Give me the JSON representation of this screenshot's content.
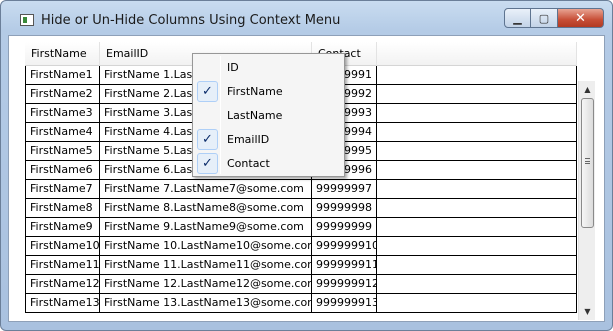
{
  "window": {
    "title": "Hide or Un-Hide Columns Using Context Menu",
    "minimize_glyph": "▁",
    "maximize_glyph": "▢",
    "close_glyph": "✕"
  },
  "grid": {
    "headers": [
      "FirstName",
      "EmailID",
      "Contact",
      ""
    ],
    "rows": [
      [
        "FirstName1",
        "FirstName 1.LastName1@some.com",
        "99999991",
        ""
      ],
      [
        "FirstName2",
        "FirstName 2.LastName2@some.com",
        "99999992",
        ""
      ],
      [
        "FirstName3",
        "FirstName 3.LastName3@some.com",
        "99999993",
        ""
      ],
      [
        "FirstName4",
        "FirstName 4.LastName4@some.com",
        "99999994",
        ""
      ],
      [
        "FirstName5",
        "FirstName 5.LastName5@some.com",
        "99999995",
        ""
      ],
      [
        "FirstName6",
        "FirstName 6.LastName6@some.com",
        "99999996",
        ""
      ],
      [
        "FirstName7",
        "FirstName 7.LastName7@some.com",
        "99999997",
        ""
      ],
      [
        "FirstName8",
        "FirstName 8.LastName8@some.com",
        "99999998",
        ""
      ],
      [
        "FirstName9",
        "FirstName 9.LastName9@some.com",
        "99999999",
        ""
      ],
      [
        "FirstName10",
        "FirstName 10.LastName10@some.com",
        "999999910",
        ""
      ],
      [
        "FirstName11",
        "FirstName 11.LastName11@some.com",
        "999999911",
        ""
      ],
      [
        "FirstName12",
        "FirstName 12.LastName12@some.com",
        "999999912",
        ""
      ],
      [
        "FirstName13",
        "FirstName 13.LastName13@some.com",
        "999999913",
        ""
      ]
    ]
  },
  "context_menu": {
    "items": [
      {
        "label": "ID",
        "checked": false
      },
      {
        "label": "FirstName",
        "checked": true
      },
      {
        "label": "LastName",
        "checked": false
      },
      {
        "label": "EmailID",
        "checked": true
      },
      {
        "label": "Contact",
        "checked": true
      }
    ],
    "check_glyph": "✓"
  },
  "scrollbar": {
    "up_glyph": "▲",
    "down_glyph": "▼"
  }
}
